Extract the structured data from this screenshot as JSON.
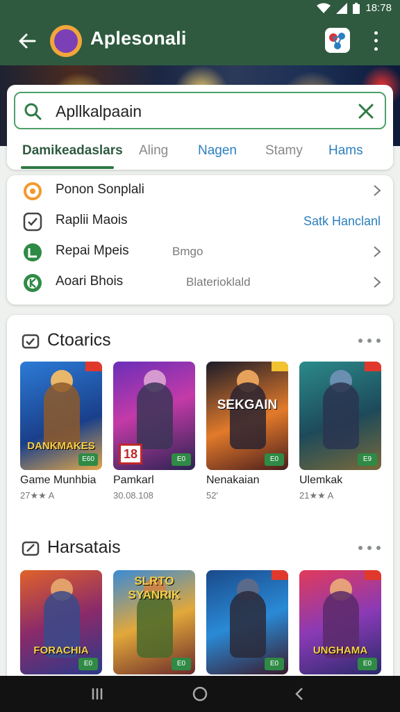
{
  "status": {
    "time": "18:78"
  },
  "appbar": {
    "title": "Aplesonali"
  },
  "search": {
    "value": "Apllkalpaain"
  },
  "tabs": [
    {
      "label": "Damikeadaslars"
    },
    {
      "label": "Aling"
    },
    {
      "label": "Nagen"
    },
    {
      "label": "Stamy"
    },
    {
      "label": "Hams"
    }
  ],
  "list": [
    {
      "label": "Ponon Sonplali",
      "mid": "",
      "right": ""
    },
    {
      "label": "Raplii Maois",
      "mid": "",
      "right": "Satk Hanclanl"
    },
    {
      "label": "Repai Mpeis",
      "mid": "Bmgo",
      "right": ""
    },
    {
      "label": "Aoari Bhois",
      "mid": "Blaterioklald",
      "right": ""
    }
  ],
  "sections": [
    {
      "title": "Ctoarics",
      "tiles": [
        {
          "name": "Game Munhbia",
          "rating": "27★★ A",
          "overlay": "DANKMAKES",
          "badge": "E60"
        },
        {
          "name": "Pamkarl",
          "rating": "30.08.108",
          "overlay": "",
          "badge": "E0",
          "num": "18"
        },
        {
          "name": "Nenakaian",
          "rating": "52'",
          "overlay": "SEKGAIN",
          "badge": "E0"
        },
        {
          "name": "Ulemkak",
          "rating": "21★★ A",
          "overlay": "",
          "badge": "E9"
        }
      ]
    },
    {
      "title": "Harsatais",
      "tiles": [
        {
          "overlay": "FORACHIA",
          "badge": "E0"
        },
        {
          "overlay": "SLRTO SYANRIK",
          "badge": "E0"
        },
        {
          "overlay": "",
          "badge": "E0"
        },
        {
          "overlay": "UNGHAMA",
          "badge": "E0"
        }
      ]
    }
  ],
  "colors": {
    "appbar": "#2f5a3f",
    "accent": "#2f7a45",
    "link": "#2a7fc0"
  }
}
